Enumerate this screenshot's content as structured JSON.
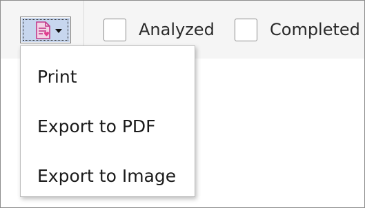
{
  "toolbar": {
    "export_button": {
      "icon": "document-export-icon",
      "has_dropdown": true
    },
    "checkboxes": [
      {
        "label": "Analyzed",
        "checked": false
      },
      {
        "label": "Completed",
        "checked": false
      }
    ]
  },
  "export_menu": {
    "items": [
      {
        "label": "Print"
      },
      {
        "label": "Export to PDF"
      },
      {
        "label": "Export to Image"
      }
    ]
  },
  "colors": {
    "toolbar_bg": "#f5f5f5",
    "button_bg": "#c7d6ee",
    "icon_accent": "#d63c8d"
  }
}
